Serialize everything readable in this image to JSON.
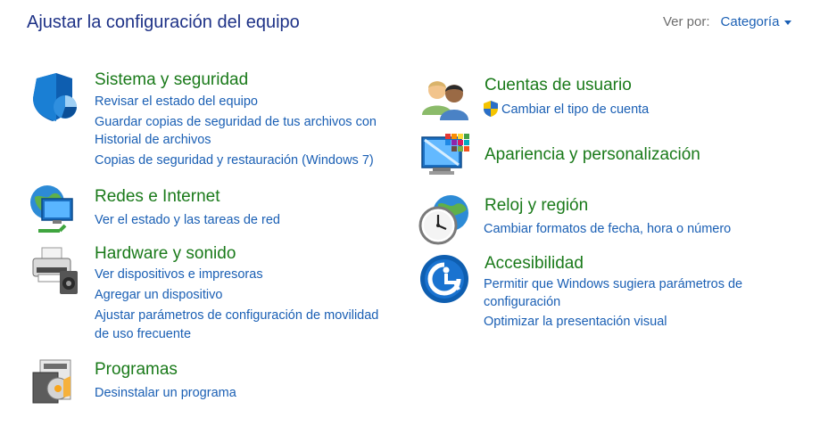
{
  "header": {
    "title": "Ajustar la configuración del equipo",
    "view_by_label": "Ver por:",
    "view_by_value": "Categoría"
  },
  "categories": {
    "system": {
      "title": "Sistema y seguridad",
      "links": [
        "Revisar el estado del equipo",
        "Guardar copias de seguridad de tus archivos con",
        "Historial de archivos",
        "Copias de seguridad y restauración (Windows 7)"
      ]
    },
    "network": {
      "title": "Redes e Internet",
      "links": [
        "Ver el estado y las tareas de red"
      ]
    },
    "hardware": {
      "title": "Hardware y sonido",
      "links": [
        "Ver dispositivos e impresoras",
        "Agregar un dispositivo",
        "Ajustar parámetros de configuración de movilidad",
        "de uso frecuente"
      ]
    },
    "programs": {
      "title": "Programas",
      "links": [
        "Desinstalar un programa"
      ]
    },
    "users": {
      "title": "Cuentas de usuario",
      "links": [
        "Cambiar el tipo de cuenta"
      ]
    },
    "appearance": {
      "title": "Apariencia y personalización",
      "links": []
    },
    "clock": {
      "title": "Reloj y región",
      "links": [
        "Cambiar formatos de fecha, hora o número"
      ]
    },
    "accessibility": {
      "title": "Accesibilidad",
      "links": [
        "Permitir que Windows sugiera parámetros de",
        "configuración",
        "Optimizar la presentación visual"
      ]
    }
  }
}
